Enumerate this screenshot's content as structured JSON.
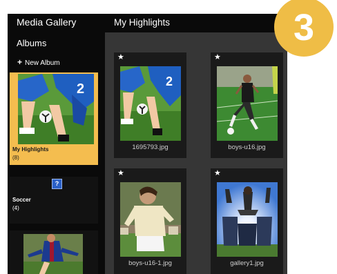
{
  "app": {
    "title": "Media Gallery"
  },
  "sidebar": {
    "albums_heading": "Albums",
    "new_album_label": "New Album",
    "albums": [
      {
        "name": "My Highlights",
        "count": "(8)",
        "selected": true
      },
      {
        "name": "Soccer",
        "count": "(4)",
        "selected": false
      }
    ]
  },
  "main": {
    "title": "My Highlights",
    "photos": [
      {
        "filename": "1695793.jpg",
        "starred": true
      },
      {
        "filename": "boys-u16.jpg",
        "starred": true
      },
      {
        "filename": "boys-u16-1.jpg",
        "starred": true
      },
      {
        "filename": "gallery1.jpg",
        "starred": true
      }
    ]
  },
  "badge": {
    "step_number": "3",
    "color": "#efbd46"
  },
  "icons": {
    "star": "star-icon",
    "help": "help-icon",
    "add": "plus-icon"
  },
  "colors": {
    "selected_album": "#f4bd4f",
    "panel": "#363636",
    "sidebar": "#0a0a0a"
  }
}
